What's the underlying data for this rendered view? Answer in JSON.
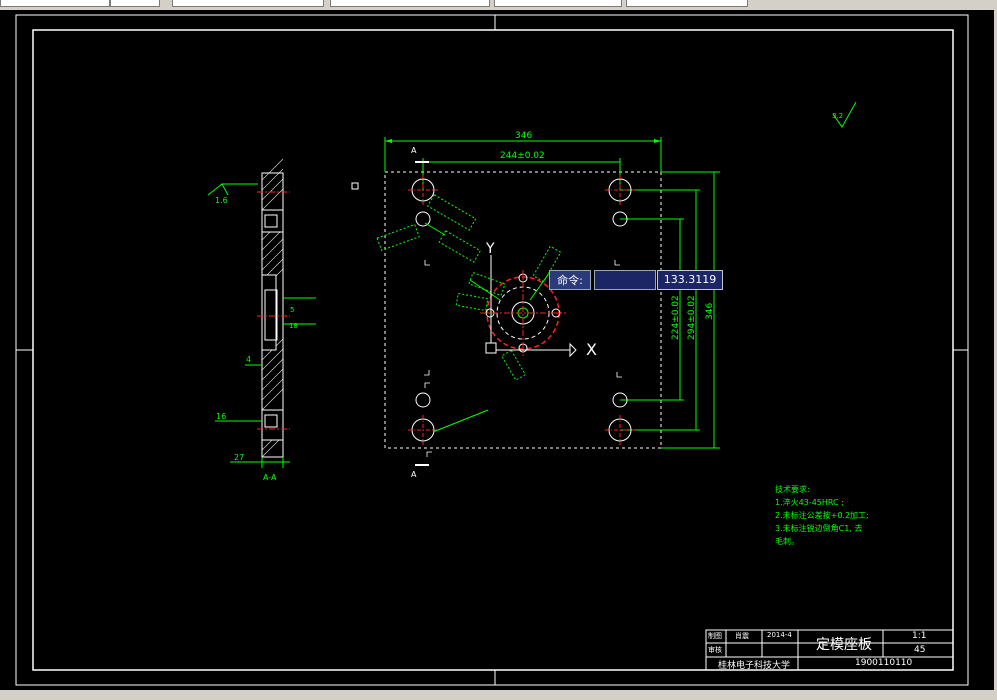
{
  "command_line": {
    "label": "命令:",
    "input_value": "",
    "coordinate_readout": "133.3119"
  },
  "dimensions": {
    "overall_width": "346",
    "hole_spacing_x": "244±0.02",
    "overall_height": "346",
    "hole_spacing_y_outer": "294±0.02",
    "hole_spacing_y_inner": "224±0.02",
    "section_thickness": "27",
    "section_dim_4": "4",
    "section_dim_bottom": "16",
    "surface_finish_left": "1.6",
    "surface_finish_right": "3.2",
    "section_dim_a": "5",
    "section_dim_b": "18"
  },
  "labels": {
    "section_mark": "A",
    "section_view": "A-A",
    "axis_y": "Y",
    "axis_x": "X"
  },
  "tech_requirements": {
    "title": "技术要求:",
    "items": [
      "1.淬火43-45HRC ;",
      "2.未标注公差按+0.2加工;",
      "3.未标注锐边倒角C1, 去",
      "毛刺。"
    ]
  },
  "title_block": {
    "role_1": "制图",
    "name_1": "肖震",
    "date": "2014-4",
    "role_2": "审核",
    "part_name": "定模座板",
    "scale": "1:1",
    "material": "45",
    "school": "桂林电子科技大学",
    "drawing_number": "1900110110"
  },
  "colors": {
    "background": "#000000",
    "dimension": "#00ff00",
    "geometry": "#ffffff",
    "centerline": "#ff2020",
    "toolbar": "#d4d0c8"
  }
}
